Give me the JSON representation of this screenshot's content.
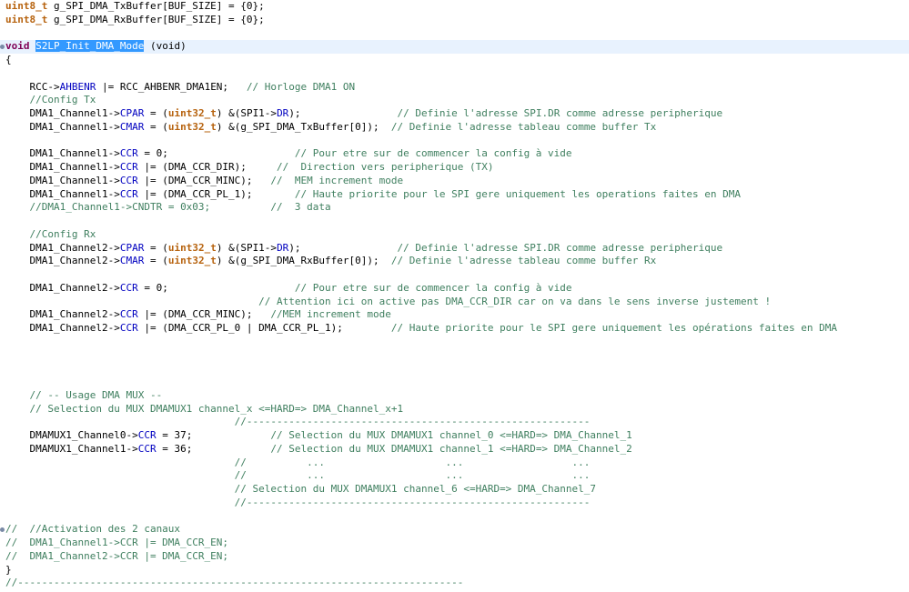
{
  "editor": {
    "current_line": 3,
    "lines": [
      [
        {
          "t": "uint8_t",
          "c": "type2"
        },
        {
          "t": " g_SPI_DMA_TxBuffer[BUF_SIZE] = {0};"
        }
      ],
      [
        {
          "t": "uint8_t",
          "c": "type2"
        },
        {
          "t": " g_SPI_DMA_RxBuffer[BUF_SIZE] = {0};"
        }
      ],
      [],
      [
        {
          "t": "void",
          "c": "type"
        },
        {
          "t": " "
        },
        {
          "t": "S2LP_Init_DMA_Mode",
          "c": "sel"
        },
        {
          "t": " (void)"
        }
      ],
      [
        {
          "t": "{"
        }
      ],
      [],
      [
        {
          "t": "    RCC->"
        },
        {
          "t": "AHBENR",
          "c": "field"
        },
        {
          "t": " |= RCC_AHBENR_DMA1EN;   "
        },
        {
          "t": "// Horloge DMA1 ON",
          "c": "comment"
        }
      ],
      [
        {
          "t": "    "
        },
        {
          "t": "//Config Tx",
          "c": "comment"
        }
      ],
      [
        {
          "t": "    DMA1_Channel1->"
        },
        {
          "t": "CPAR",
          "c": "field"
        },
        {
          "t": " = ("
        },
        {
          "t": "uint32_t",
          "c": "type2"
        },
        {
          "t": ") &(SPI1->"
        },
        {
          "t": "DR",
          "c": "field"
        },
        {
          "t": ");                "
        },
        {
          "t": "// Definie l'adresse SPI.DR comme adresse peripherique",
          "c": "comment"
        }
      ],
      [
        {
          "t": "    DMA1_Channel1->"
        },
        {
          "t": "CMAR",
          "c": "field"
        },
        {
          "t": " = ("
        },
        {
          "t": "uint32_t",
          "c": "type2"
        },
        {
          "t": ") &(g_SPI_DMA_TxBuffer[0]);  "
        },
        {
          "t": "// Definie l'adresse tableau comme buffer Tx",
          "c": "comment"
        }
      ],
      [],
      [
        {
          "t": "    DMA1_Channel1->"
        },
        {
          "t": "CCR",
          "c": "field"
        },
        {
          "t": " = 0;                     "
        },
        {
          "t": "// Pour etre sur de commencer la config à vide",
          "c": "comment"
        }
      ],
      [
        {
          "t": "    DMA1_Channel1->"
        },
        {
          "t": "CCR",
          "c": "field"
        },
        {
          "t": " |= (DMA_CCR_DIR);     "
        },
        {
          "t": "//  Direction vers peripherique (TX)",
          "c": "comment"
        }
      ],
      [
        {
          "t": "    DMA1_Channel1->"
        },
        {
          "t": "CCR",
          "c": "field"
        },
        {
          "t": " |= (DMA_CCR_MINC);   "
        },
        {
          "t": "//  MEM increment mode",
          "c": "comment"
        }
      ],
      [
        {
          "t": "    DMA1_Channel1->"
        },
        {
          "t": "CCR",
          "c": "field"
        },
        {
          "t": " |= (DMA_CCR_PL_1);       "
        },
        {
          "t": "// Haute priorite pour le SPI gere uniquement les operations faites en DMA",
          "c": "comment"
        }
      ],
      [
        {
          "t": "    "
        },
        {
          "t": "//DMA1_Channel1->CNDTR = 0x03;          //  3 data",
          "c": "comment"
        }
      ],
      [],
      [
        {
          "t": "    "
        },
        {
          "t": "//Config Rx",
          "c": "comment"
        }
      ],
      [
        {
          "t": "    DMA1_Channel2->"
        },
        {
          "t": "CPAR",
          "c": "field"
        },
        {
          "t": " = ("
        },
        {
          "t": "uint32_t",
          "c": "type2"
        },
        {
          "t": ") &(SPI1->"
        },
        {
          "t": "DR",
          "c": "field"
        },
        {
          "t": ");                "
        },
        {
          "t": "// Definie l'adresse SPI.DR comme adresse peripherique",
          "c": "comment"
        }
      ],
      [
        {
          "t": "    DMA1_Channel2->"
        },
        {
          "t": "CMAR",
          "c": "field"
        },
        {
          "t": " = ("
        },
        {
          "t": "uint32_t",
          "c": "type2"
        },
        {
          "t": ") &(g_SPI_DMA_RxBuffer[0]);  "
        },
        {
          "t": "// Definie l'adresse tableau comme buffer Rx",
          "c": "comment"
        }
      ],
      [],
      [
        {
          "t": "    DMA1_Channel2->"
        },
        {
          "t": "CCR",
          "c": "field"
        },
        {
          "t": " = 0;                     "
        },
        {
          "t": "// Pour etre sur de commencer la config à vide",
          "c": "comment"
        }
      ],
      [
        {
          "t": "                                          "
        },
        {
          "t": "// Attention ici on active pas DMA_CCR_DIR car on va dans le sens inverse justement !",
          "c": "comment"
        }
      ],
      [
        {
          "t": "    DMA1_Channel2->"
        },
        {
          "t": "CCR",
          "c": "field"
        },
        {
          "t": " |= (DMA_CCR_MINC);   "
        },
        {
          "t": "//MEM increment mode",
          "c": "comment"
        }
      ],
      [
        {
          "t": "    DMA1_Channel2->"
        },
        {
          "t": "CCR",
          "c": "field"
        },
        {
          "t": " |= (DMA_CCR_PL_0 | DMA_CCR_PL_1);        "
        },
        {
          "t": "// Haute priorite pour le SPI gere uniquement les opérations faites en DMA",
          "c": "comment"
        }
      ],
      [],
      [],
      [],
      [],
      [
        {
          "t": "    "
        },
        {
          "t": "// -- Usage DMA MUX --",
          "c": "comment"
        }
      ],
      [
        {
          "t": "    "
        },
        {
          "t": "// Selection du MUX DMAMUX1 channel_x <=HARD=> DMA_Channel_x+1",
          "c": "comment"
        }
      ],
      [
        {
          "t": "                                      "
        },
        {
          "t": "//---------------------------------------------------------",
          "c": "comment"
        }
      ],
      [
        {
          "t": "    DMAMUX1_Channel0->"
        },
        {
          "t": "CCR",
          "c": "field"
        },
        {
          "t": " = 37;             "
        },
        {
          "t": "// Selection du MUX DMAMUX1 channel_0 <=HARD=> DMA_Channel_1",
          "c": "comment"
        }
      ],
      [
        {
          "t": "    DMAMUX1_Channel1->"
        },
        {
          "t": "CCR",
          "c": "field"
        },
        {
          "t": " = 36;             "
        },
        {
          "t": "// Selection du MUX DMAMUX1 channel_1 <=HARD=> DMA_Channel_2",
          "c": "comment"
        }
      ],
      [
        {
          "t": "                                      "
        },
        {
          "t": "//          ...                    ...                  ...",
          "c": "comment"
        }
      ],
      [
        {
          "t": "                                      "
        },
        {
          "t": "//          ...                    ...                  ...",
          "c": "comment"
        }
      ],
      [
        {
          "t": "                                      "
        },
        {
          "t": "// Selection du MUX DMAMUX1 channel_6 <=HARD=> DMA_Channel_7",
          "c": "comment"
        }
      ],
      [
        {
          "t": "                                      "
        },
        {
          "t": "//---------------------------------------------------------",
          "c": "comment"
        }
      ],
      [],
      [
        {
          "t": "//  //Activation des 2 canaux",
          "c": "comment"
        }
      ],
      [
        {
          "t": "//  DMA1_Channel1->CCR |= DMA_CCR_EN;",
          "c": "comment"
        }
      ],
      [
        {
          "t": "//  DMA1_Channel2->CCR |= DMA_CCR_EN;",
          "c": "comment"
        }
      ],
      [
        {
          "t": "}"
        }
      ],
      [
        {
          "t": "//--------------------------------------------------------------------------",
          "c": "comment"
        }
      ]
    ]
  }
}
